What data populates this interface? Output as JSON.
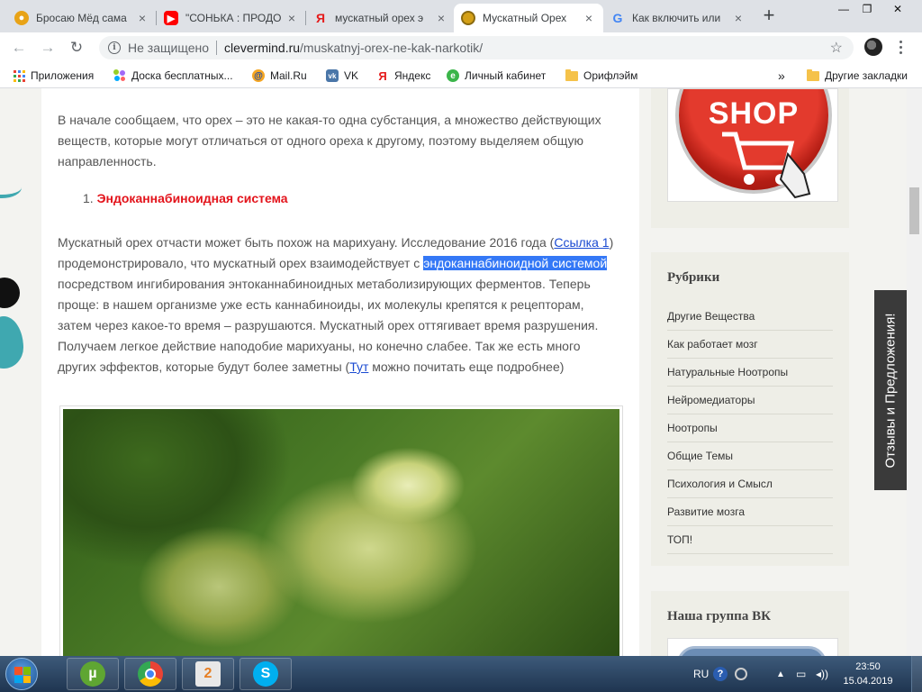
{
  "tabs": [
    {
      "title": "Бросаю Мёд сама",
      "favicon": "bee-icon",
      "color": "#e8a317",
      "close": "×"
    },
    {
      "title": "\"СОНЬКА : ПРОДО",
      "favicon": "youtube-icon",
      "color": "#ff0000",
      "close": "×"
    },
    {
      "title": "мускатный орех э",
      "favicon": "yandex-icon",
      "color": "#e51b1b",
      "close": "×"
    },
    {
      "title": "Мускатный Орех",
      "favicon": "site-icon",
      "color": "#d4a017",
      "close": "×",
      "active": true
    },
    {
      "title": "Как включить или",
      "favicon": "google-icon",
      "color": "#4285f4",
      "close": "×"
    }
  ],
  "new_tab": "+",
  "window_controls": {
    "minimize": "—",
    "maximize": "❐",
    "close": "✕"
  },
  "omnibox": {
    "security_text": "Не защищено",
    "host": "clevermind.ru",
    "path": "/muskatnyj-orex-ne-kak-narkotik/"
  },
  "bookmarks": [
    {
      "label": "Приложения",
      "icon": "apps-icon"
    },
    {
      "label": "Доска бесплатных...",
      "icon": "avito-icon"
    },
    {
      "label": "Mail.Ru",
      "icon": "mailru-icon"
    },
    {
      "label": "VK",
      "icon": "vk-icon"
    },
    {
      "label": "Яндекс",
      "icon": "yandex-icon"
    },
    {
      "label": "Личный кабинет",
      "icon": "cabinet-icon"
    },
    {
      "label": "Орифлэйм",
      "icon": "folder-icon"
    }
  ],
  "bookmarks_more": "»",
  "other_bookmarks": "Другие закладки",
  "article": {
    "para1": "В начале сообщаем, что орех – это не какая-то одна субстанция, а множество действующих веществ, которые могут отличаться от одного ореха к другому, поэтому выделяем общую направленность.",
    "list_number": "1.",
    "list_heading": "Эндоканнабиноидная система",
    "para2_a": "Мускатный орех отчасти может быть похож на марихуану. Исследование 2016 года (",
    "link1": "Ссылка 1",
    "para2_b": ") продемонстрировало, что мускатный орех взаимодействует с ",
    "highlight": "эндоканнабиноидной системой",
    "para2_c": " посредством ингибирования энтоканнабиноидных метаболизирующих ферментов. Теперь проще: в нашем организме уже есть каннабиноиды, их молекулы крепятся к рецепторам, затем через какое-то время – разрушаются. Мускатный орех оттягивает время разрушения. Получаем легкое действие наподобие марихуаны, но конечно слабее. Так же есть много других эффектов, которые будут более заметны (",
    "link2": "Тут",
    "para2_d": " можно почитать еще подробнее)"
  },
  "sidebar": {
    "shop_text": "SHOP",
    "categories_title": "Рубрики",
    "categories": [
      "Другие Вещества",
      "Как работает мозг",
      "Натуральные Ноотропы",
      "Нейромедиаторы",
      "Ноотропы",
      "Общие Темы",
      "Психология и Смысл",
      "Развитие мозга",
      "ТОП!"
    ],
    "vk_title": "Наша группа ВК"
  },
  "feedback_label": "Отзывы и Предложения!",
  "taskbar": {
    "language": "RU",
    "time": "23:50",
    "date": "15.04.2019"
  },
  "colors": {
    "accent_red": "#e3131b",
    "link": "#1a4ad1",
    "selection": "#3478f6",
    "sidebar_bg": "#eeeee7"
  }
}
